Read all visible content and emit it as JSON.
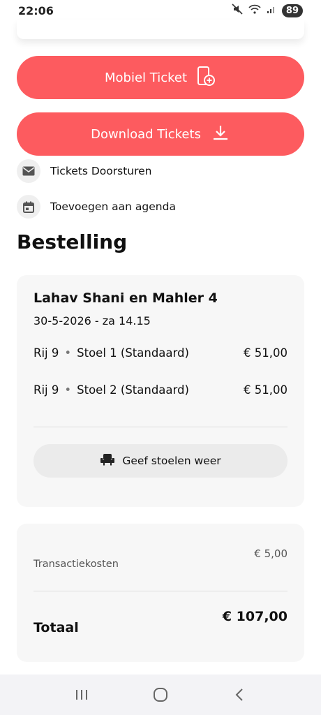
{
  "status": {
    "time": "22:06",
    "battery": "89"
  },
  "buttons": {
    "mobile_ticket": "Mobiel Ticket",
    "download_tickets": "Download Tickets"
  },
  "actions": {
    "forward": "Tickets Doorsturen",
    "calendar": "Toevoegen aan agenda"
  },
  "order": {
    "title": "Bestelling",
    "event_name": "Lahav Shani en Mahler 4",
    "event_date": "30-5-2026 - za 14.15",
    "seats": [
      {
        "row": "Rij 9",
        "seat": "Stoel 1 (Standaard)",
        "price": "€ 51,00"
      },
      {
        "row": "Rij 9",
        "seat": "Stoel 2 (Standaard)",
        "price": "€ 51,00"
      }
    ],
    "return_seats": "Geef stoelen weer"
  },
  "totals": {
    "fee_label": "Transactiekosten",
    "fee_amount": "€ 5,00",
    "total_label": "Totaal",
    "total_amount": "€ 107,00"
  },
  "colors": {
    "accent": "#fd5b5f",
    "card": "#f7f7f7"
  },
  "icons": {
    "mute": "mute-icon",
    "wifi": "wifi-icon",
    "signal": "signal-icon",
    "mobile_ticket": "phone-add-icon",
    "download": "download-icon",
    "mail": "mail-icon",
    "calendar": "calendar-icon",
    "seat": "seat-icon",
    "nav_recent": "recent-apps-icon",
    "nav_home": "home-icon",
    "nav_back": "back-icon"
  }
}
